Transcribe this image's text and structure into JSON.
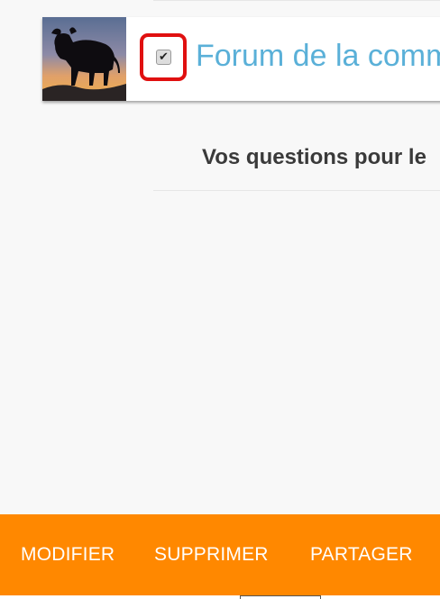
{
  "forum": {
    "title": "Forum de la comm",
    "checked_mark": "✔",
    "thumbnail": "bull-silhouette-sunset-thumbnail"
  },
  "subtitle": "Vos questions pour le",
  "actions": {
    "modify": "MODIFIER",
    "delete": "SUPPRIMER",
    "share": "PARTAGER"
  },
  "colors": {
    "accent": "#ff8800",
    "link": "#5ab0d8",
    "highlight": "#e01010"
  }
}
